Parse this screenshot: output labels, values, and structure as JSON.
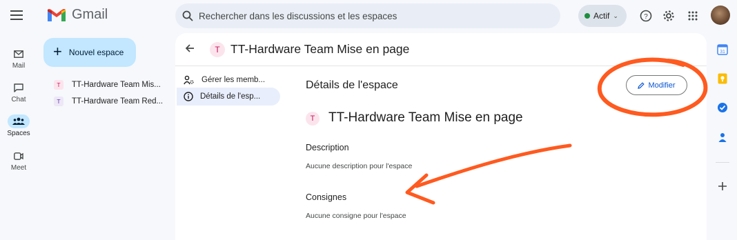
{
  "app": {
    "name": "Gmail"
  },
  "search": {
    "placeholder": "Rechercher dans les discussions et les espaces"
  },
  "status": {
    "label": "Actif"
  },
  "rail": {
    "items": [
      {
        "label": "Mail",
        "icon": "mail-icon"
      },
      {
        "label": "Chat",
        "icon": "chat-icon"
      },
      {
        "label": "Spaces",
        "icon": "spaces-icon"
      },
      {
        "label": "Meet",
        "icon": "meet-icon"
      }
    ]
  },
  "sidebar": {
    "new_space_label": "Nouvel espace",
    "spaces": [
      {
        "badge": "T",
        "name": "TT-Hardware Team Mis..."
      },
      {
        "badge": "T",
        "name": "TT-Hardware Team Red..."
      }
    ]
  },
  "header": {
    "badge": "T",
    "title": "TT-Hardware Team Mise en page"
  },
  "nav": {
    "items": [
      {
        "label": "Gérer les memb...",
        "icon": "manage-members-icon"
      },
      {
        "label": "Détails de l'esp...",
        "icon": "info-icon"
      }
    ]
  },
  "details": {
    "section_title": "Détails de l'espace",
    "edit_label": "Modifier",
    "space_badge": "T",
    "space_name": "TT-Hardware Team Mise en page",
    "description_label": "Description",
    "description_value": "Aucune description pour l'espace",
    "guidelines_label": "Consignes",
    "guidelines_value": "Aucune consigne pour l'espace"
  },
  "colors": {
    "accent": "#0b57d0",
    "new_space_bg": "#c2e7ff",
    "annotation": "#ff5a1f",
    "status_green": "#1e8e3e"
  }
}
